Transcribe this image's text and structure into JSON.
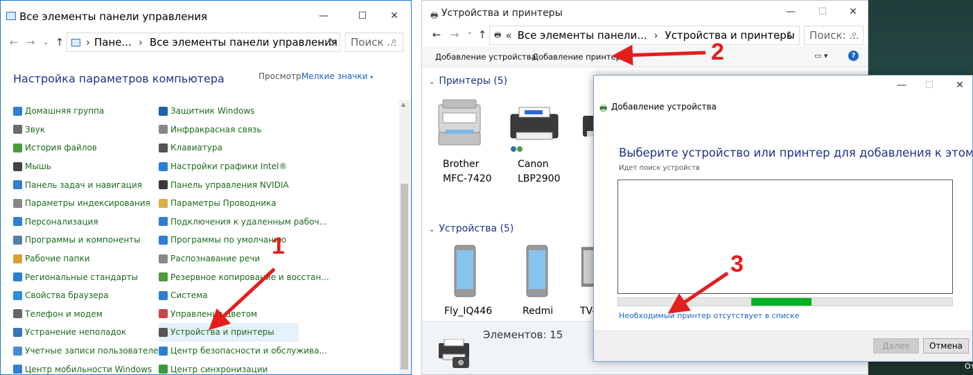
{
  "control_panel": {
    "title": "Все элементы панели управления",
    "breadcrumb_root": "Пане...",
    "breadcrumb_current": "Все элементы панели управления",
    "search_placeholder": "Поиск ...",
    "heading": "Настройка параметров компьютера",
    "view_label": "Просмотр:",
    "view_value": "Мелкие значки",
    "left_items": [
      "Домашняя группа",
      "Звук",
      "История файлов",
      "Мышь",
      "Панель задач и навигация",
      "Параметры индексирования",
      "Персонализация",
      "Программы и компоненты",
      "Рабочие папки",
      "Региональные стандарты",
      "Свойства браузера",
      "Телефон и модем",
      "Устранение неполадок",
      "Учетные записи пользователей",
      "Центр мобильности Windows"
    ],
    "right_items": [
      "Защитник Windows",
      "Инфракрасная связь",
      "Клавиатура",
      "Настройки графики Intel®",
      "Панель управления NVIDIA",
      "Параметры Проводника",
      "Подключения к удаленным рабоч...",
      "Программы по умолчанию",
      "Распознавание речи",
      "Резервное копирование и восстан...",
      "Система",
      "Управление цветом",
      "Устройства и принтеры",
      "Центр безопасности и обслужива...",
      "Центр синхронизации"
    ]
  },
  "devices_window": {
    "title": "Устройства и принтеры",
    "breadcrumb_parent": "Все элементы панели...",
    "breadcrumb_current": "Устройства и принтеры",
    "search_placeholder": "Поиск: ...",
    "add_device": "Добавление устройства",
    "add_printer": "Добавление принтера",
    "printers_header": "Принтеры (5)",
    "devices_header": "Устройства (5)",
    "printers": [
      {
        "line1": "Brother",
        "line2": "MFC-7420"
      },
      {
        "line1": "Canon",
        "line2": "LBP2900"
      }
    ],
    "devices": [
      "Fly_IQ446",
      "Redmi",
      "TV-"
    ],
    "status": "Элементов: 15"
  },
  "dialog": {
    "title": "Добавление устройства",
    "heading": "Выберите устройство или принтер для добавления к этому ПК",
    "subtext": "Идет поиск устройств",
    "progress_fraction": 0.18,
    "link": "Необходимый принтер отсутствует в списке",
    "next_button": "Далее",
    "cancel_button": "Отмена"
  },
  "annotations": [
    "1",
    "2",
    "3"
  ],
  "corner_text": "От",
  "colors": {
    "accent_blue": "#1e3287",
    "link_blue": "#1a66c4",
    "item_green": "#1a6b1a",
    "progress_green": "#06b025",
    "arrow_red": "#e41d1d"
  }
}
